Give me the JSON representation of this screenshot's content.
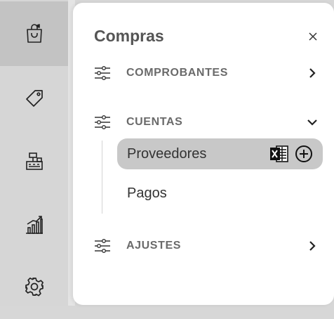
{
  "rail": {
    "items": [
      {
        "icon": "shopping-bag-icon",
        "active": true
      },
      {
        "icon": "tag-icon",
        "active": false
      },
      {
        "icon": "cash-register-icon",
        "active": false
      },
      {
        "icon": "bar-chart-icon",
        "active": false
      },
      {
        "icon": "gear-icon",
        "active": false
      }
    ]
  },
  "panel": {
    "title": "Compras",
    "close_symbol": "×",
    "sections": [
      {
        "label": "COMPROBANTES",
        "expanded": false
      },
      {
        "label": "CUENTAS",
        "expanded": true,
        "children": [
          {
            "label": "Proveedores",
            "selected": true,
            "actions": [
              "excel-icon",
              "add-circle-icon"
            ]
          },
          {
            "label": "Pagos",
            "selected": false
          }
        ]
      },
      {
        "label": "AJUSTES",
        "expanded": false
      }
    ]
  },
  "colors": {
    "rail_bg": "#d6d6d6",
    "rail_active": "#c3c3c3",
    "panel_bg": "#ffffff",
    "selected_bg": "#c8c8c8",
    "text_dark": "#333333",
    "text_muted": "#6a6a6a"
  }
}
